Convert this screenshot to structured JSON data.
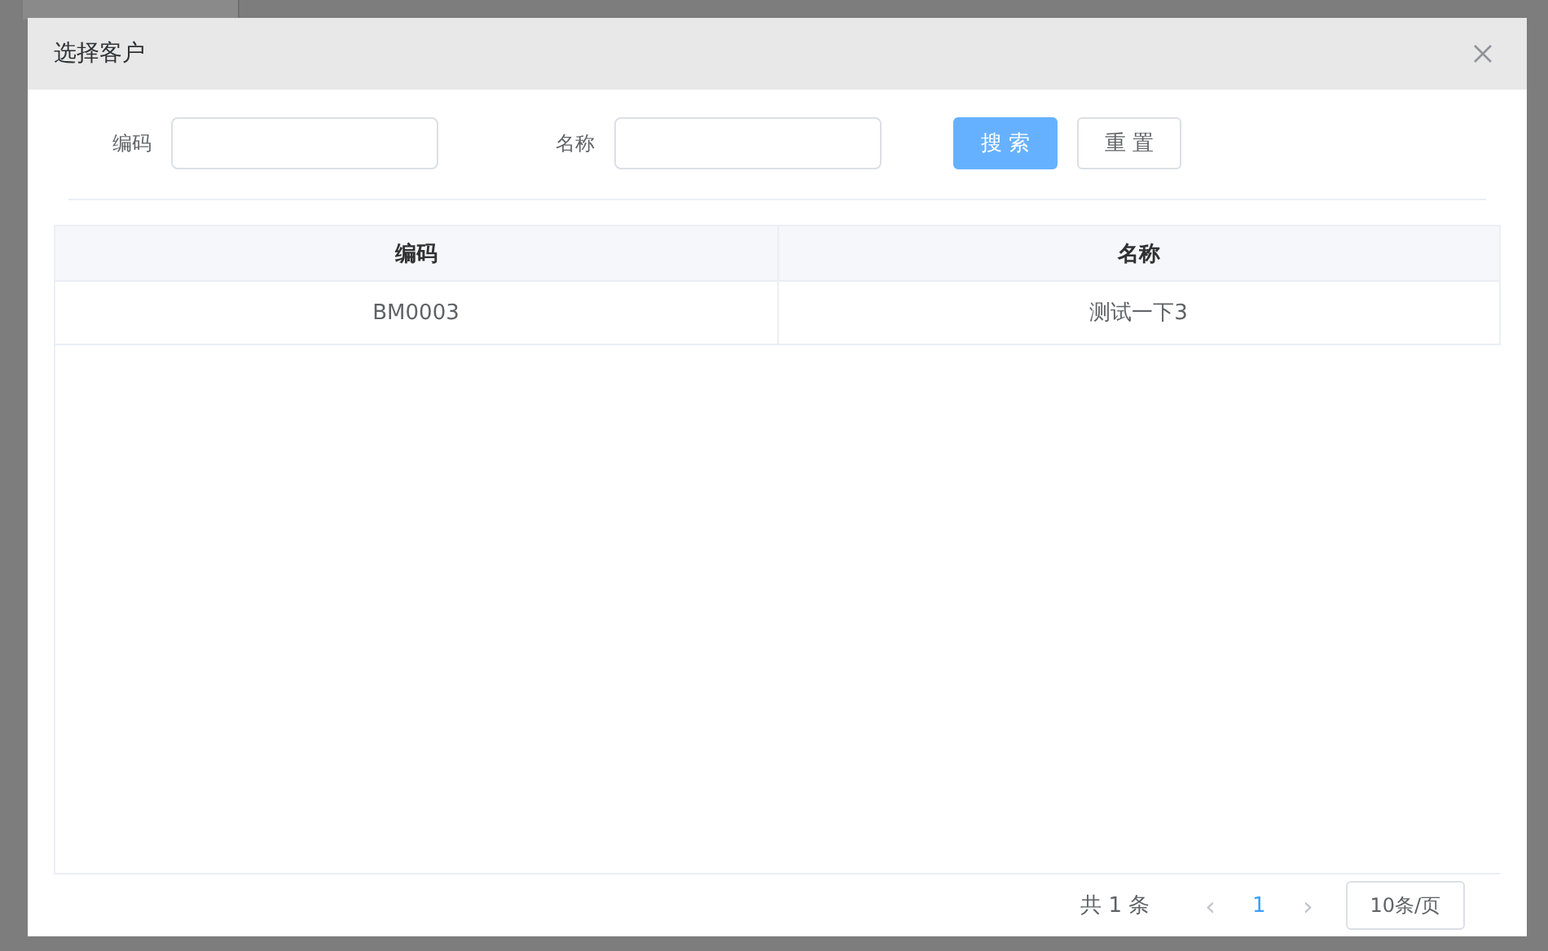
{
  "dialog": {
    "title": "选择客户"
  },
  "filters": [
    {
      "label": "编码"
    },
    {
      "label": "名称"
    }
  ],
  "buttons": [
    {
      "label": "搜 索",
      "kind": "primary"
    },
    {
      "label": "重 置",
      "kind": "default"
    }
  ],
  "table": {
    "columns": [
      "编码",
      "名称"
    ],
    "rows": [
      [
        "BM0003",
        "测试一下3"
      ]
    ]
  },
  "pagination": {
    "total": "共 1 条",
    "prev": "‹",
    "pages": [
      {
        "label": "1",
        "selected": true
      }
    ],
    "next": "›",
    "page_size": "10条/页"
  }
}
